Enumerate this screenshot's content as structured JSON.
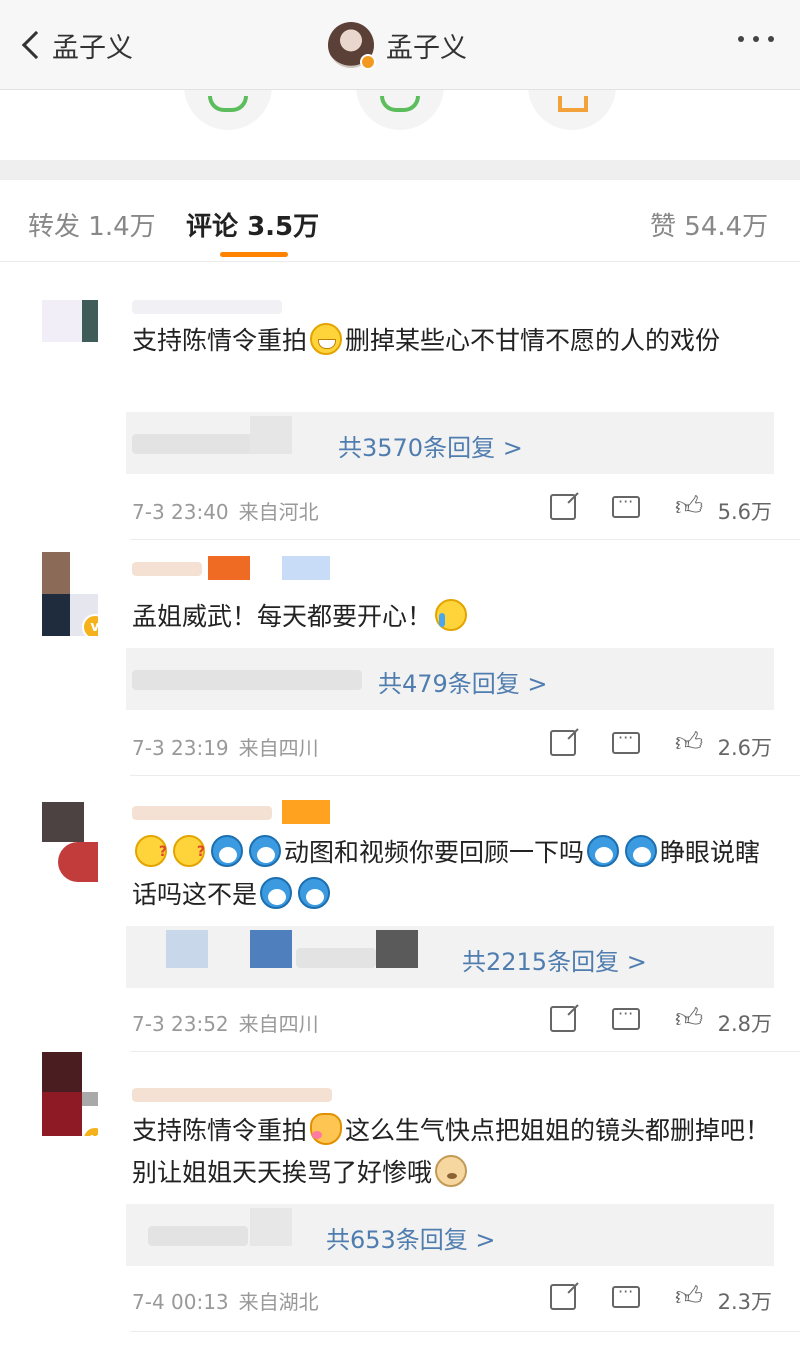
{
  "header": {
    "back_label": "孟子义",
    "title": "孟子义"
  },
  "tabs": {
    "repost_label": "转发",
    "repost_count": "1.4万",
    "comment_label": "评论",
    "comment_count": "3.5万",
    "like_label": "赞",
    "like_count": "54.4万"
  },
  "comments": [
    {
      "text": "支持陈情令重拍",
      "text2": "删掉某些心不甘情不愿的人的戏份",
      "reply_text": "共3570条回复 >",
      "time": "7-3 23:40",
      "source": "来自河北",
      "likes": "5.6万"
    },
    {
      "text": "孟姐威武！每天都要开心！",
      "reply_text": "共479条回复 >",
      "time": "7-3 23:19",
      "source": "来自四川",
      "likes": "2.6万"
    },
    {
      "text": "动图和视频你要回顾一下吗",
      "text2": "睁眼说瞎话吗这不是",
      "reply_text": "共2215条回复 >",
      "time": "7-3 23:52",
      "source": "来自四川",
      "likes": "2.8万"
    },
    {
      "text": "支持陈情令重拍",
      "text2": "这么生气快点把姐姐的镜头都删掉吧！ 别让姐姐天天挨骂了好惨哦",
      "reply_text": "共653条回复 >",
      "time": "7-4 00:13",
      "source": "来自湖北",
      "likes": "2.3万"
    }
  ]
}
